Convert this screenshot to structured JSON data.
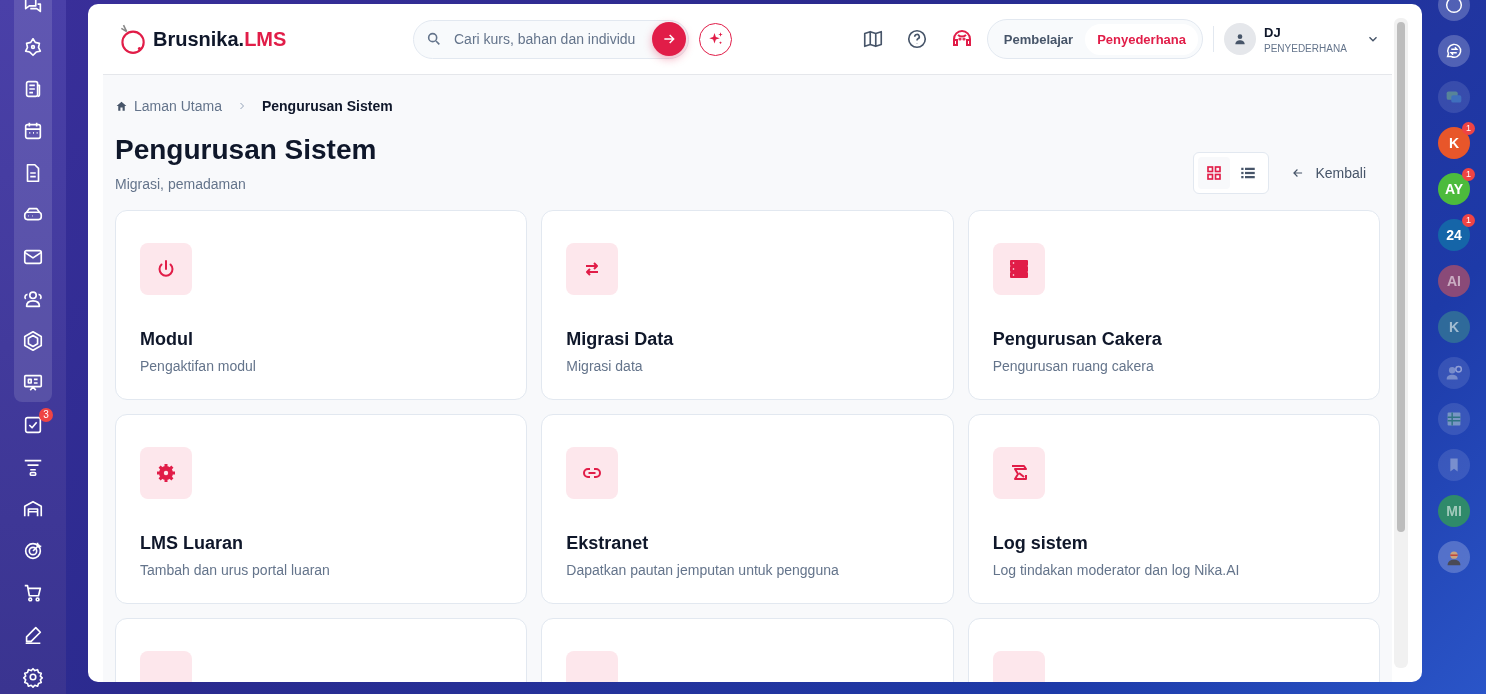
{
  "left_sidebar": {
    "items": [
      {
        "kind": "chat"
      },
      {
        "kind": "star"
      },
      {
        "kind": "news"
      },
      {
        "kind": "calendar"
      },
      {
        "kind": "document"
      },
      {
        "kind": "drive"
      },
      {
        "kind": "mail"
      },
      {
        "kind": "users"
      },
      {
        "kind": "hexagon"
      },
      {
        "kind": "presentation"
      },
      {
        "kind": "task",
        "badge": "3"
      },
      {
        "kind": "funnel"
      },
      {
        "kind": "garage"
      },
      {
        "kind": "target"
      },
      {
        "kind": "cart"
      },
      {
        "kind": "pen"
      },
      {
        "kind": "settings"
      }
    ]
  },
  "header": {
    "logo": {
      "name": "Brusnika.",
      "accent": "LMS"
    },
    "search": {
      "placeholder": "Cari kurs, bahan dan individu"
    },
    "mode_toggle": [
      {
        "label": "Pembelajar",
        "selected": false
      },
      {
        "label": "Penyederhana",
        "selected": true
      }
    ],
    "user": {
      "name": "DJ",
      "role": "PENYEDERHANA"
    }
  },
  "breadcrumb": [
    {
      "label": "Laman Utama",
      "kind": "home"
    },
    {
      "label": "Pengurusan Sistem",
      "kind": "current"
    }
  ],
  "page": {
    "title": "Pengurusan Sistem",
    "subtitle": "Migrasi, pemadaman",
    "back_label": "Kembali"
  },
  "view_toggle": [
    {
      "kind": "grid",
      "selected": true
    },
    {
      "kind": "list",
      "selected": false
    }
  ],
  "cards": [
    {
      "kind": "power",
      "title": "Modul",
      "subtitle": "Pengaktifan modul"
    },
    {
      "kind": "swap",
      "title": "Migrasi Data",
      "subtitle": "Migrasi data"
    },
    {
      "kind": "server",
      "title": "Pengurusan Cakera",
      "subtitle": "Pengurusan ruang cakera"
    },
    {
      "kind": "gear",
      "title": "LMS Luaran",
      "subtitle": "Tambah dan urus portal luaran"
    },
    {
      "kind": "link",
      "title": "Ekstranet",
      "subtitle": "Dapatkan pautan jemputan untuk pengguna"
    },
    {
      "kind": "log",
      "title": "Log sistem",
      "subtitle": "Log tindakan moderator dan log Nika.AI"
    },
    {
      "kind": "blank"
    },
    {
      "kind": "blank"
    },
    {
      "kind": "blank"
    }
  ],
  "right_rail": {
    "items": [
      {
        "kind": "toggle",
        "dimmed": false
      },
      {
        "kind": "swapchat",
        "dimmed": false
      },
      {
        "kind": "messages",
        "dimmed": true
      },
      {
        "kind": "avatar",
        "initials": "K",
        "color": "#e8562a",
        "badge": "1",
        "dimmed": false
      },
      {
        "kind": "avatar",
        "initials": "AY",
        "color": "#4cbb3c",
        "badge": "1",
        "dimmed": false
      },
      {
        "kind": "avatar",
        "initials": "24",
        "color": "#1565a8",
        "badge": "1",
        "dimmed": false
      },
      {
        "kind": "avatar",
        "initials": "AI",
        "color": "#8a4a78",
        "dimmed": true
      },
      {
        "kind": "avatar",
        "initials": "K",
        "color": "#2f6a9a",
        "dimmed": true
      },
      {
        "kind": "contact",
        "dimmed": true
      },
      {
        "kind": "table",
        "dimmed": true
      },
      {
        "kind": "bookmark",
        "dimmed": true
      },
      {
        "kind": "avatar",
        "initials": "MI",
        "color": "#2f8a6a",
        "dimmed": true
      },
      {
        "kind": "person",
        "dimmed": false
      }
    ]
  }
}
